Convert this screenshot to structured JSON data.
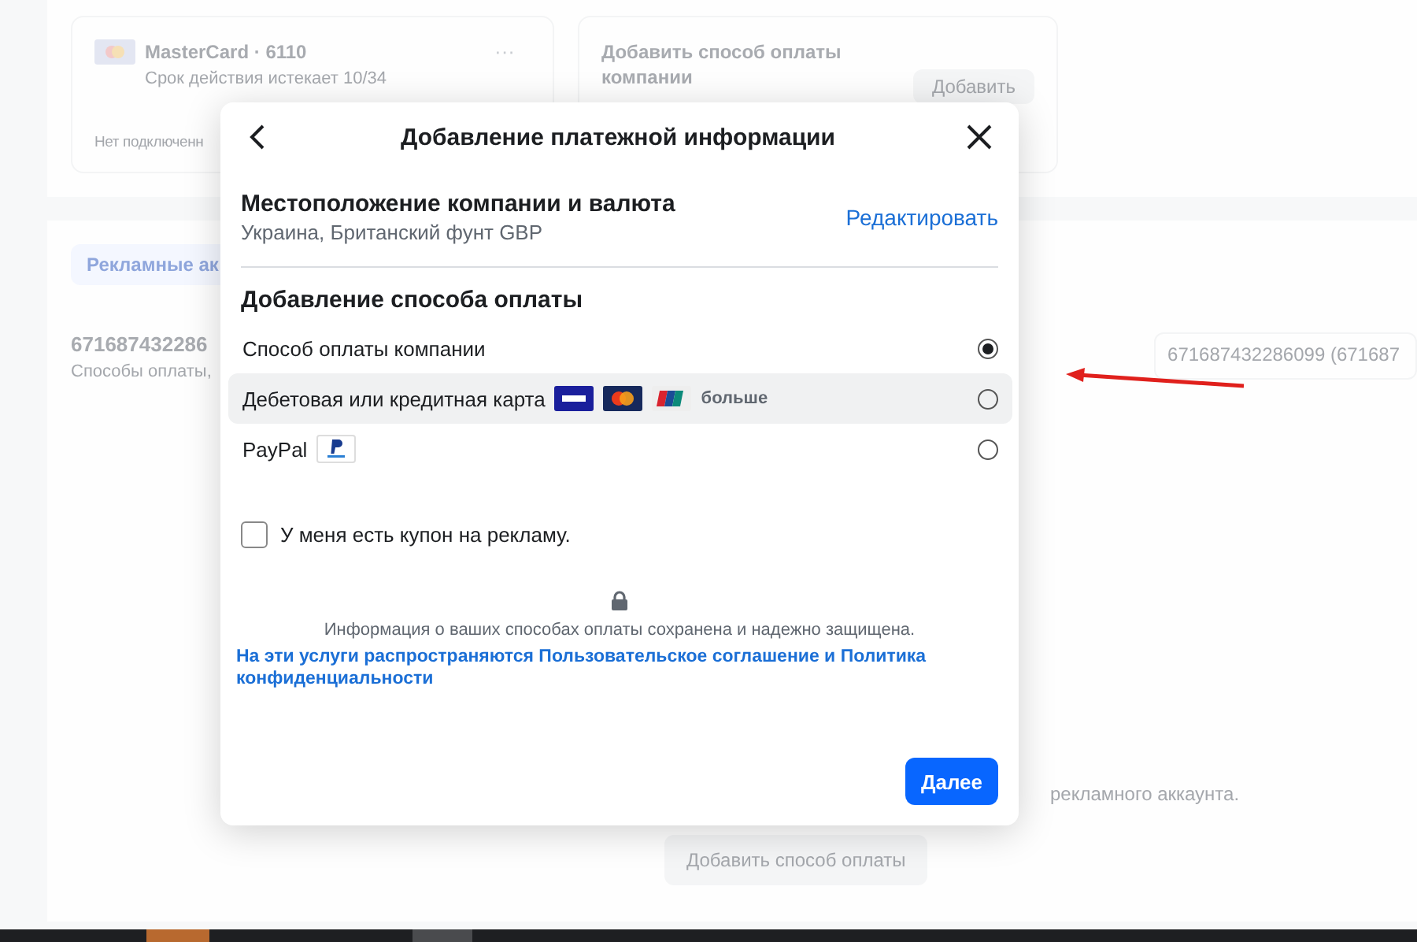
{
  "background": {
    "saved_card": {
      "name": "MasterCard · 6110",
      "expiry": "Срок действия истекает 10/34",
      "more": "···",
      "footer": "Нет подключенн"
    },
    "add_card": {
      "title": "Добавить способ оплаты компании",
      "button": "Добавить"
    },
    "tab": "Рекламные ак",
    "account": {
      "id": "671687432286",
      "subtitle": "Способы оплаты,"
    },
    "account_select": "671687432286099 (671687",
    "note": "рекламного аккаунта.",
    "add_button": "Добавить способ оплаты"
  },
  "dialog": {
    "title": "Добавление платежной информации",
    "location": {
      "title": "Местоположение компании и валюта",
      "value": "Украина, Британский фунт GBP",
      "edit": "Редактировать"
    },
    "methods_title": "Добавление способа оплаты",
    "methods": [
      {
        "kind": "company",
        "label": "Способ оплаты компании",
        "selected": true,
        "highlighted": false
      },
      {
        "kind": "card",
        "label": "Дебетовая или кредитная карта",
        "more": "больше",
        "selected": false,
        "highlighted": true
      },
      {
        "kind": "paypal",
        "label": "PayPal",
        "selected": false,
        "highlighted": false
      }
    ],
    "coupon": {
      "label": "У меня есть купон на рекламу.",
      "checked": false
    },
    "security_note": "Информация о ваших способах оплаты сохранена и надежно защищена.",
    "terms": "На эти услуги распространяются Пользовательское соглашение и Политика конфиденциальности",
    "next": "Далее"
  }
}
